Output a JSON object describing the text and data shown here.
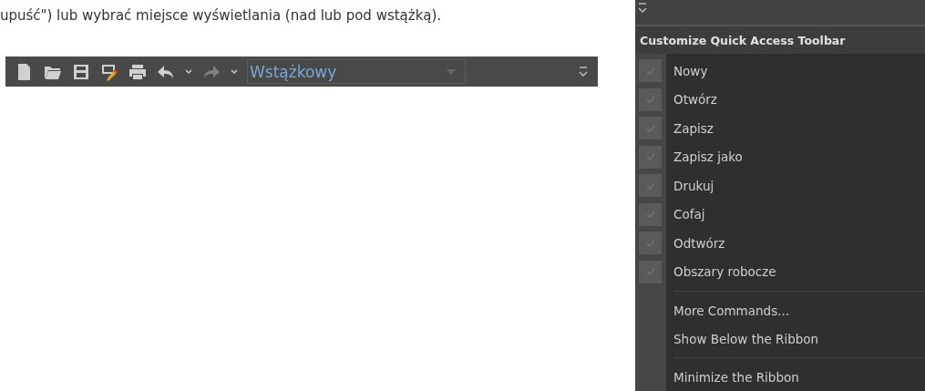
{
  "intro_text": "upuść\") lub wybrać miejsce wyświetlania (nad lub pod wstążką).",
  "toolbar": {
    "buttons": [
      {
        "kind": "new"
      },
      {
        "kind": "open"
      },
      {
        "kind": "save"
      },
      {
        "kind": "save-as"
      },
      {
        "kind": "print"
      },
      {
        "kind": "undo",
        "disabled": false
      },
      {
        "kind": "caret"
      },
      {
        "kind": "redo",
        "disabled": true
      },
      {
        "kind": "caret"
      }
    ],
    "workspace_combo": {
      "value": "Wstążkowy"
    }
  },
  "menu": {
    "title": "Customize Quick Access Toolbar",
    "items": [
      {
        "label": "Nowy",
        "checked": true
      },
      {
        "label": "Otwórz",
        "checked": true
      },
      {
        "label": "Zapisz",
        "checked": true
      },
      {
        "label": "Zapisz jako",
        "checked": true
      },
      {
        "label": "Drukuj",
        "checked": true
      },
      {
        "label": "Cofaj",
        "checked": true
      },
      {
        "label": "Odtwórz",
        "checked": true
      },
      {
        "label": "Obszary robocze",
        "checked": true
      }
    ],
    "command_groups": [
      {
        "items": [
          {
            "label": "More Commands..."
          },
          {
            "label": "Show Below the Ribbon"
          }
        ]
      },
      {
        "items": [
          {
            "label": "Minimize the Ribbon"
          }
        ]
      }
    ]
  }
}
